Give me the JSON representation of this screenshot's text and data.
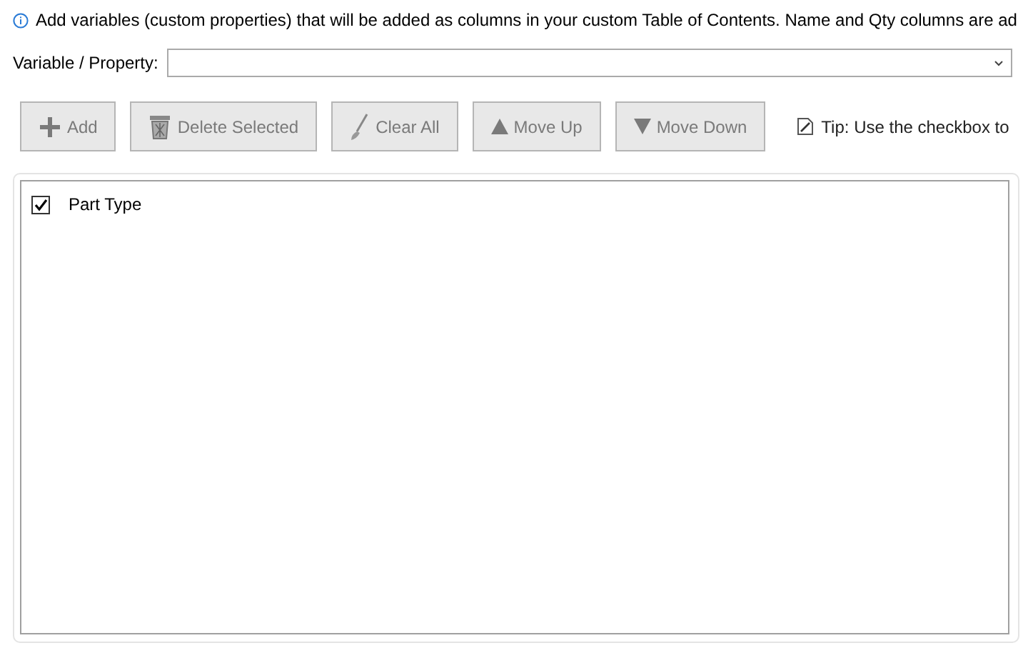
{
  "info": "Add variables (custom properties) that will be added as columns in your custom Table of Contents. Name and Qty columns are ad",
  "field": {
    "label": "Variable / Property:"
  },
  "buttons": [
    {
      "label": "Add",
      "disabled": true
    },
    {
      "label": "Delete Selected",
      "disabled": true
    },
    {
      "label": "Clear All",
      "disabled": true
    },
    {
      "label": "Move Up",
      "disabled": true
    },
    {
      "label": "Move Down",
      "disabled": true
    }
  ],
  "tip": "Tip: Use the checkbox to",
  "items": [
    {
      "label": "Part Type",
      "checked": true
    }
  ]
}
